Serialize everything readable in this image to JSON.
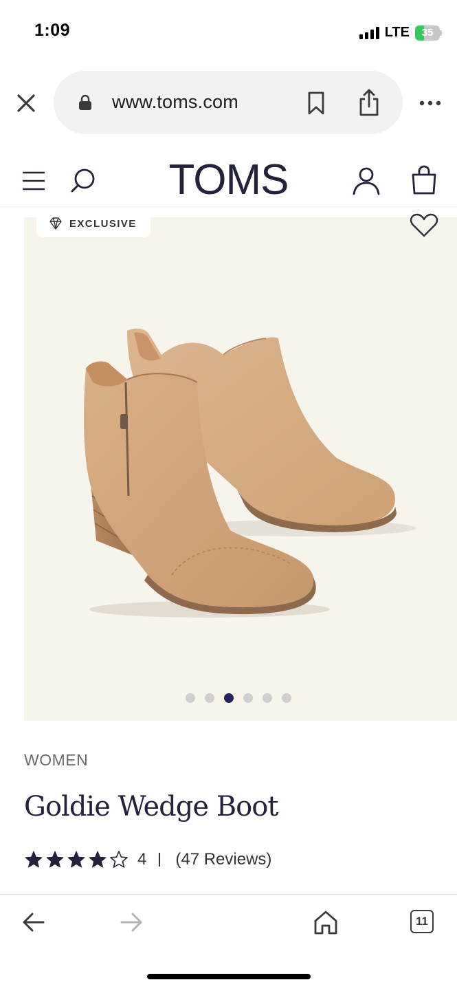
{
  "status_bar": {
    "time": "1:09",
    "network": "LTE",
    "battery_level": "35",
    "battery_fraction": 0.35
  },
  "browser": {
    "url": "www.toms.com"
  },
  "site_header": {
    "logo_text": "TOMS"
  },
  "product": {
    "badge_label": "EXCLUSIVE",
    "image_count": 6,
    "active_image_index": 2,
    "category": "WOMEN",
    "title": "Goldie Wedge Boot",
    "rating": {
      "stars_filled": 4,
      "stars_total": 5,
      "value": "4",
      "reviews_label": "(47 Reviews)"
    }
  },
  "bottom_bar": {
    "tab_count": "11"
  },
  "colors": {
    "brand_navy": "#24245a",
    "hero_background": "#f7f4ec",
    "boot_suede": "#d2a67c",
    "battery_green": "#34c759"
  }
}
